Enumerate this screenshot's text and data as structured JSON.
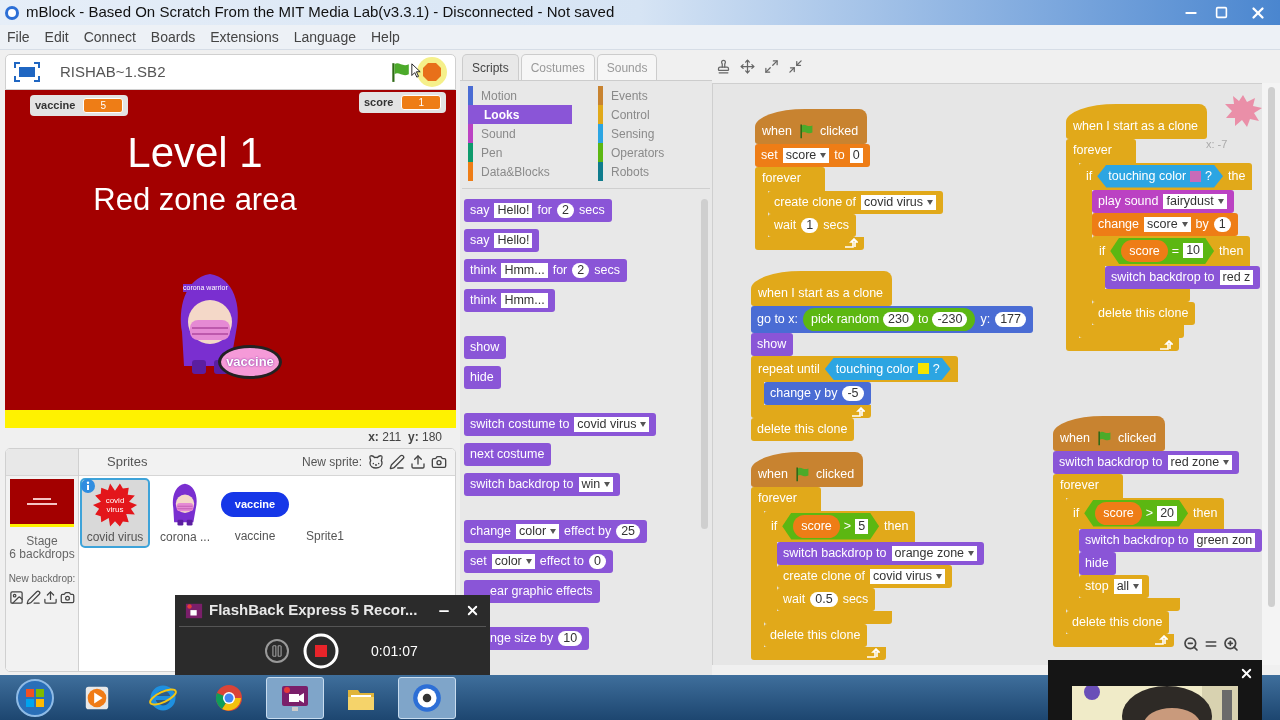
{
  "window": {
    "title": "mBlock - Based On Scratch From the MIT Media Lab(v3.3.1) - Disconnected - Not saved"
  },
  "menu": [
    "File",
    "Edit",
    "Connect",
    "Boards",
    "Extensions",
    "Language",
    "Help"
  ],
  "stage": {
    "project_name": "RISHAB~1.SB2",
    "monitors": [
      {
        "label": "vaccine",
        "value": "5"
      },
      {
        "label": "score",
        "value": "1"
      }
    ],
    "title": "Level 1",
    "subtitle": "Red zone area",
    "character_text": "corona warrior",
    "bowl_text": "vaccine",
    "coords": "**x:** 211  **y:** 180"
  },
  "sprites": {
    "header": "Sprites",
    "new_sprite": "New sprite:",
    "stage_label": "Stage",
    "backdrops": "6 backdrops",
    "new_backdrop": "New backdrop:",
    "items": [
      {
        "name": "covid virus",
        "selected": true,
        "kind": "virus",
        "thumb_text": "covid virus"
      },
      {
        "name": "corona ...",
        "selected": false,
        "kind": "figure"
      },
      {
        "name": "vaccine",
        "selected": false,
        "kind": "pill",
        "thumb_text": "vaccine"
      },
      {
        "name": "Sprite1",
        "selected": false,
        "kind": "none"
      }
    ]
  },
  "palette": {
    "tabs": [
      {
        "label": "Scripts",
        "selected": true
      },
      {
        "label": "Costumes",
        "selected": false
      },
      {
        "label": "Sounds",
        "selected": false
      }
    ],
    "categories": [
      {
        "label": "Motion",
        "color": "#4a6cd4",
        "selected": false
      },
      {
        "label": "Looks",
        "color": "#8a55d7",
        "selected": true
      },
      {
        "label": "Sound",
        "color": "#bb42c3",
        "selected": false
      },
      {
        "label": "Pen",
        "color": "#0e9a6c",
        "selected": false
      },
      {
        "label": "Data&Blocks",
        "color": "#ee7d16",
        "selected": false
      },
      {
        "label": "Events",
        "color": "#c88330",
        "selected": false
      },
      {
        "label": "Control",
        "color": "#e1a91a",
        "selected": false
      },
      {
        "label": "Sensing",
        "color": "#2ca5e2",
        "selected": false
      },
      {
        "label": "Operators",
        "color": "#5cb712",
        "selected": false
      },
      {
        "label": "Robots",
        "color": "#0f7c8d",
        "selected": false
      }
    ],
    "groups": [
      [
        {
          "kind": "stack",
          "color": "#8a55d7",
          "covered": false,
          "parts": [
            {
              "kind": "text",
              "text": "say"
            },
            {
              "kind": "field",
              "text": "Hello!"
            },
            {
              "kind": "text",
              "text": "for"
            },
            {
              "kind": "num",
              "text": "2"
            },
            {
              "kind": "text",
              "text": "secs"
            }
          ]
        },
        {
          "kind": "stack",
          "color": "#8a55d7",
          "covered": false,
          "parts": [
            {
              "kind": "text",
              "text": "say"
            },
            {
              "kind": "field",
              "text": "Hello!"
            }
          ]
        },
        {
          "kind": "stack",
          "color": "#8a55d7",
          "covered": false,
          "parts": [
            {
              "kind": "text",
              "text": "think"
            },
            {
              "kind": "field",
              "text": "Hmm..."
            },
            {
              "kind": "text",
              "text": "for"
            },
            {
              "kind": "num",
              "text": "2"
            },
            {
              "kind": "text",
              "text": "secs"
            }
          ]
        },
        {
          "kind": "stack",
          "color": "#8a55d7",
          "covered": false,
          "parts": [
            {
              "kind": "text",
              "text": "think"
            },
            {
              "kind": "field",
              "text": "Hmm..."
            }
          ]
        }
      ],
      [
        {
          "kind": "stack",
          "color": "#8a55d7",
          "covered": false,
          "parts": [
            {
              "kind": "text",
              "text": "show"
            }
          ]
        },
        {
          "kind": "stack",
          "color": "#8a55d7",
          "covered": false,
          "parts": [
            {
              "kind": "text",
              "text": "hide"
            }
          ]
        }
      ],
      [
        {
          "kind": "stack",
          "color": "#8a55d7",
          "covered": false,
          "parts": [
            {
              "kind": "text",
              "text": "switch costume to"
            },
            {
              "kind": "menu",
              "text": "covid virus"
            }
          ]
        },
        {
          "kind": "stack",
          "color": "#8a55d7",
          "covered": false,
          "parts": [
            {
              "kind": "text",
              "text": "next costume"
            }
          ]
        },
        {
          "kind": "stack",
          "color": "#8a55d7",
          "covered": false,
          "parts": [
            {
              "kind": "text",
              "text": "switch backdrop to"
            },
            {
              "kind": "menu",
              "text": "win"
            }
          ]
        }
      ],
      [
        {
          "kind": "stack",
          "color": "#8a55d7",
          "covered": false,
          "parts": [
            {
              "kind": "text",
              "text": "change"
            },
            {
              "kind": "menu",
              "text": "color"
            },
            {
              "kind": "text",
              "text": "effect by"
            },
            {
              "kind": "num",
              "text": "25"
            }
          ]
        },
        {
          "kind": "stack",
          "color": "#8a55d7",
          "covered": false,
          "parts": [
            {
              "kind": "text",
              "text": "set"
            },
            {
              "kind": "menu",
              "text": "color"
            },
            {
              "kind": "text",
              "text": "effect to"
            },
            {
              "kind": "num",
              "text": "0"
            }
          ]
        },
        {
          "kind": "stack",
          "color": "#8a55d7",
          "covered": true,
          "parts": [
            {
              "kind": "text",
              "text": "ear graphic effects"
            }
          ]
        }
      ],
      [
        {
          "kind": "stack",
          "color": "#8a55d7",
          "covered": true,
          "parts": [
            {
              "kind": "text",
              "text": "nge size by"
            },
            {
              "kind": "num",
              "text": "10"
            }
          ]
        }
      ]
    ]
  },
  "scripts_area": {
    "sprite_x": "x: -7",
    "scripts": [
      {
        "blocks": [
          {
            "kind": "hat",
            "color": "#c88330",
            "parts": [
              {
                "kind": "text",
                "text": "when"
              },
              {
                "kind": "flag"
              },
              {
                "kind": "text",
                "text": "clicked"
              }
            ]
          },
          {
            "kind": "stack",
            "color": "#ee7d16",
            "parts": [
              {
                "kind": "text",
                "text": "set"
              },
              {
                "kind": "menu",
                "text": "score"
              },
              {
                "kind": "text",
                "text": "to"
              },
              {
                "kind": "field",
                "text": "0"
              }
            ]
          },
          {
            "kind": "c",
            "color": "#e1a91a",
            "loop": true,
            "parts": [
              {
                "kind": "text",
                "text": "forever"
              }
            ],
            "children": [
              {
                "kind": "stack",
                "color": "#e1a91a",
                "parts": [
                  {
                    "kind": "text",
                    "text": "create clone of"
                  },
                  {
                    "kind": "menu",
                    "text": "covid virus"
                  }
                ]
              },
              {
                "kind": "stack",
                "color": "#e1a91a",
                "parts": [
                  {
                    "kind": "text",
                    "text": "wait"
                  },
                  {
                    "kind": "num",
                    "text": "1"
                  },
                  {
                    "kind": "text",
                    "text": "secs"
                  }
                ]
              }
            ]
          }
        ]
      },
      {
        "blocks": [
          {
            "kind": "hat",
            "color": "#e1a91a",
            "parts": [
              {
                "kind": "text",
                "text": "when I start as a clone"
              }
            ]
          },
          {
            "kind": "stack",
            "color": "#4a6cd4",
            "parts": [
              {
                "kind": "text",
                "text": "go to x:"
              },
              {
                "kind": "reporter",
                "color": "#5cb712",
                "parts": [
                  {
                    "kind": "text",
                    "text": "pick random"
                  },
                  {
                    "kind": "num",
                    "text": "230"
                  },
                  {
                    "kind": "text",
                    "text": "to"
                  },
                  {
                    "kind": "num",
                    "text": "-230"
                  }
                ]
              },
              {
                "kind": "text",
                "text": "y:"
              },
              {
                "kind": "num",
                "text": "177"
              }
            ]
          },
          {
            "kind": "stack",
            "color": "#8a55d7",
            "parts": [
              {
                "kind": "text",
                "text": "show"
              }
            ]
          },
          {
            "kind": "c",
            "color": "#e1a91a",
            "loop": true,
            "parts": [
              {
                "kind": "text",
                "text": "repeat until"
              },
              {
                "kind": "bool",
                "color": "#2ca5e2",
                "parts": [
                  {
                    "kind": "text",
                    "text": "touching color"
                  },
                  {
                    "kind": "swatch",
                    "color": "#f5e400"
                  },
                  {
                    "kind": "text",
                    "text": "?"
                  }
                ]
              }
            ],
            "children": [
              {
                "kind": "stack",
                "color": "#4a6cd4",
                "parts": [
                  {
                    "kind": "text",
                    "text": "change y by"
                  },
                  {
                    "kind": "num",
                    "text": "-5"
                  }
                ]
              }
            ]
          },
          {
            "kind": "stack",
            "color": "#e1a91a",
            "parts": [
              {
                "kind": "text",
                "text": "delete this clone"
              }
            ]
          }
        ]
      },
      {
        "blocks": [
          {
            "kind": "hat",
            "color": "#c88330",
            "parts": [
              {
                "kind": "text",
                "text": "when"
              },
              {
                "kind": "flag"
              },
              {
                "kind": "text",
                "text": "clicked"
              }
            ]
          },
          {
            "kind": "c",
            "color": "#e1a91a",
            "loop": true,
            "parts": [
              {
                "kind": "text",
                "text": "forever"
              }
            ],
            "children": [
              {
                "kind": "c",
                "color": "#e1a91a",
                "loop": false,
                "parts": [
                  {
                    "kind": "text",
                    "text": "if"
                  },
                  {
                    "kind": "bool",
                    "color": "#5cb712",
                    "parts": [
                      {
                        "kind": "reporter",
                        "color": "#ee7d16",
                        "parts": [
                          {
                            "kind": "text",
                            "text": "score"
                          }
                        ]
                      },
                      {
                        "kind": "text",
                        "text": ">"
                      },
                      {
                        "kind": "field",
                        "text": "5"
                      }
                    ]
                  },
                  {
                    "kind": "text",
                    "text": "then"
                  }
                ],
                "children": [
                  {
                    "kind": "stack",
                    "color": "#8a55d7",
                    "parts": [
                      {
                        "kind": "text",
                        "text": "switch backdrop to"
                      },
                      {
                        "kind": "menu",
                        "text": "orange zone"
                      }
                    ]
                  },
                  {
                    "kind": "stack",
                    "color": "#e1a91a",
                    "parts": [
                      {
                        "kind": "text",
                        "text": "create clone of"
                      },
                      {
                        "kind": "menu",
                        "text": "covid virus"
                      }
                    ]
                  },
                  {
                    "kind": "stack",
                    "color": "#e1a91a",
                    "parts": [
                      {
                        "kind": "text",
                        "text": "wait"
                      },
                      {
                        "kind": "num",
                        "text": "0.5"
                      },
                      {
                        "kind": "text",
                        "text": "secs"
                      }
                    ]
                  }
                ]
              },
              {
                "kind": "stack",
                "color": "#e1a91a",
                "parts": [
                  {
                    "kind": "text",
                    "text": "delete this clone"
                  }
                ]
              }
            ]
          }
        ]
      },
      {
        "blocks": [
          {
            "kind": "hat",
            "color": "#e1a91a",
            "parts": [
              {
                "kind": "text",
                "text": "when I start as a clone"
              }
            ]
          },
          {
            "kind": "c",
            "color": "#e1a91a",
            "loop": true,
            "parts": [
              {
                "kind": "text",
                "text": "forever"
              }
            ],
            "children": [
              {
                "kind": "c",
                "color": "#e1a91a",
                "loop": false,
                "parts": [
                  {
                    "kind": "text",
                    "text": "if"
                  },
                  {
                    "kind": "bool",
                    "color": "#2ca5e2",
                    "parts": [
                      {
                        "kind": "text",
                        "text": "touching color"
                      },
                      {
                        "kind": "swatch",
                        "color": "#c86bb8"
                      },
                      {
                        "kind": "text",
                        "text": "?"
                      }
                    ]
                  },
                  {
                    "kind": "text",
                    "text": "the"
                  }
                ],
                "children": [
                  {
                    "kind": "stack",
                    "color": "#bb42c3",
                    "parts": [
                      {
                        "kind": "text",
                        "text": "play sound"
                      },
                      {
                        "kind": "menu",
                        "text": "fairydust"
                      }
                    ]
                  },
                  {
                    "kind": "stack",
                    "color": "#ee7d16",
                    "parts": [
                      {
                        "kind": "text",
                        "text": "change"
                      },
                      {
                        "kind": "menu",
                        "text": "score"
                      },
                      {
                        "kind": "text",
                        "text": "by"
                      },
                      {
                        "kind": "num",
                        "text": "1"
                      }
                    ]
                  },
                  {
                    "kind": "c",
                    "color": "#e1a91a",
                    "loop": false,
                    "parts": [
                      {
                        "kind": "text",
                        "text": "if"
                      },
                      {
                        "kind": "bool",
                        "color": "#5cb712",
                        "parts": [
                          {
                            "kind": "reporter",
                            "color": "#ee7d16",
                            "parts": [
                              {
                                "kind": "text",
                                "text": "score"
                              }
                            ]
                          },
                          {
                            "kind": "text",
                            "text": "="
                          },
                          {
                            "kind": "field",
                            "text": "10"
                          }
                        ]
                      },
                      {
                        "kind": "text",
                        "text": "then"
                      }
                    ],
                    "children": [
                      {
                        "kind": "stack",
                        "color": "#8a55d7",
                        "parts": [
                          {
                            "kind": "text",
                            "text": "switch backdrop to"
                          },
                          {
                            "kind": "field",
                            "text": "red z"
                          }
                        ]
                      }
                    ]
                  },
                  {
                    "kind": "stack",
                    "color": "#e1a91a",
                    "parts": [
                      {
                        "kind": "text",
                        "text": "delete this clone"
                      }
                    ]
                  }
                ]
              }
            ]
          }
        ]
      },
      {
        "blocks": [
          {
            "kind": "hat",
            "color": "#c88330",
            "parts": [
              {
                "kind": "text",
                "text": "when"
              },
              {
                "kind": "flag"
              },
              {
                "kind": "text",
                "text": "clicked"
              }
            ]
          },
          {
            "kind": "stack",
            "color": "#8a55d7",
            "parts": [
              {
                "kind": "text",
                "text": "switch backdrop to"
              },
              {
                "kind": "menu",
                "text": "red zone"
              }
            ]
          },
          {
            "kind": "c",
            "color": "#e1a91a",
            "loop": true,
            "parts": [
              {
                "kind": "text",
                "text": "forever"
              }
            ],
            "children": [
              {
                "kind": "c",
                "color": "#e1a91a",
                "loop": false,
                "parts": [
                  {
                    "kind": "text",
                    "text": "if"
                  },
                  {
                    "kind": "bool",
                    "color": "#5cb712",
                    "parts": [
                      {
                        "kind": "reporter",
                        "color": "#ee7d16",
                        "parts": [
                          {
                            "kind": "text",
                            "text": "score"
                          }
                        ]
                      },
                      {
                        "kind": "text",
                        "text": ">"
                      },
                      {
                        "kind": "field",
                        "text": "20"
                      }
                    ]
                  },
                  {
                    "kind": "text",
                    "text": "then"
                  }
                ],
                "children": [
                  {
                    "kind": "stack",
                    "color": "#8a55d7",
                    "parts": [
                      {
                        "kind": "text",
                        "text": "switch backdrop to"
                      },
                      {
                        "kind": "field",
                        "text": "green zon"
                      }
                    ]
                  },
                  {
                    "kind": "stack",
                    "color": "#8a55d7",
                    "parts": [
                      {
                        "kind": "text",
                        "text": "hide"
                      }
                    ]
                  },
                  {
                    "kind": "stack",
                    "color": "#e1a91a",
                    "parts": [
                      {
                        "kind": "text",
                        "text": "stop"
                      },
                      {
                        "kind": "menu",
                        "text": "all"
                      }
                    ]
                  }
                ]
              },
              {
                "kind": "stack",
                "color": "#e1a91a",
                "parts": [
                  {
                    "kind": "text",
                    "text": "delete this clone"
                  }
                ]
              }
            ]
          }
        ]
      }
    ]
  },
  "recorder": {
    "title": "FlashBack Express 5 Recor...",
    "time": "0:01:07"
  },
  "taskbar": [
    {
      "kind": "start",
      "active": false
    },
    {
      "kind": "media",
      "active": false
    },
    {
      "kind": "browser_e",
      "active": false
    },
    {
      "kind": "browser_c",
      "active": false
    },
    {
      "kind": "recorder",
      "active": true
    },
    {
      "kind": "folder",
      "active": false
    },
    {
      "kind": "app",
      "active": true
    }
  ]
}
